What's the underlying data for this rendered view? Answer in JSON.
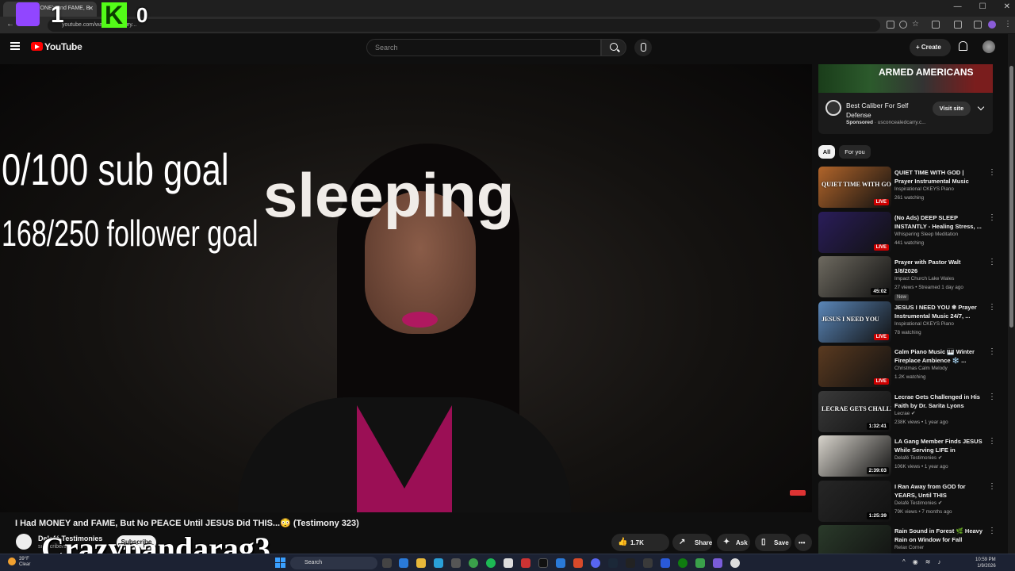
{
  "browser": {
    "tab_title": "I Had MONEY and FAME, B",
    "url": "youtube.com/watch?v=...bey...",
    "window_controls": [
      "—",
      "☐",
      "✕"
    ]
  },
  "stream_overlay": {
    "twitch_count": "1",
    "kick_letter": "K",
    "kick_count": "0",
    "sub_goal": "0/100 sub goal",
    "follower_goal": "168/250 follower goal",
    "status_text": "sleeping",
    "streamer_name": "Crazypandarag3"
  },
  "header": {
    "logo_text": "YouTube",
    "search_placeholder": "Search",
    "create_label": "+ Create"
  },
  "video": {
    "title": "I Had MONEY and FAME, But No PEACE Until JESUS Did THIS...😳 (Testimony 323)",
    "channel": "Delafé Testimonies",
    "subscribers": "subscribers",
    "subscribe_label": "Subscribe",
    "likes": "1.7K",
    "share_label": "Share",
    "ask_label": "Ask",
    "save_label": "Save",
    "more_label": "•••"
  },
  "ad": {
    "banner_text": "ARMED AMERICANS",
    "title": "Best Caliber For Self Defense",
    "sponsored_label": "Sponsored",
    "advertiser": "usconcealedcarry.c...",
    "visit_label": "Visit site"
  },
  "chips": [
    "All",
    "For you"
  ],
  "recommendations": [
    {
      "title": "QUIET TIME WITH GOD | Prayer Instrumental Music 24/7, ...",
      "channel": "Inspirational CKEYS Piano",
      "meta": "261 watching",
      "badge": "LIVE",
      "thumb_text": "QUIET TIME WITH GOD",
      "thumb_color": "#b0642a"
    },
    {
      "title": "(No Ads) DEEP SLEEP INSTANTLY - Healing Stress, ...",
      "channel": "Whispering Sleep Meditation",
      "meta": "441 watching",
      "badge": "LIVE",
      "thumb_text": "",
      "thumb_color": "#2a1d5a"
    },
    {
      "title": "Prayer with Pastor Walt 1/8/2026",
      "channel": "Impact Church Lake Wales",
      "meta": "27 views • Streamed 1 day ago",
      "badge": "45:02",
      "new_label": "New",
      "thumb_text": "",
      "thumb_color": "#6e6a60"
    },
    {
      "title": "JESUS I NEED YOU ❄ Prayer Instrumental Music 24/7, ...",
      "channel": "Inspirational CKEYS Piano",
      "meta": "78 watching",
      "badge": "LIVE",
      "thumb_text": "JESUS I NEED YOU",
      "thumb_color": "#5a86b8"
    },
    {
      "title": "Calm Piano Music 🎹 Winter Fireplace Ambience ❄️ ...",
      "channel": "Christmas Calm Melody",
      "meta": "1.2K watching",
      "badge": "LIVE",
      "thumb_text": "",
      "thumb_color": "#5a3a20"
    },
    {
      "title": "Lecrae Gets Challenged in His Faith by Dr. Sarita Lyons",
      "channel": "Lecrae ✔",
      "meta": "238K views • 1 year ago",
      "badge": "1:32:41",
      "thumb_text": "LECRAE GETS CHALLENG",
      "thumb_color": "#3a3a3a"
    },
    {
      "title": "LA Gang Member Finds JESUS While Serving LIFE in PRISON....",
      "channel": "Delafé Testimonies ✔",
      "meta": "106K views • 1 year ago",
      "badge": "2:39:03",
      "thumb_text": "",
      "thumb_color": "#d8d4cc"
    },
    {
      "title": "I Ran Away from GOD for YEARS, Until THIS Happened....",
      "channel": "Delafé Testimonies ✔",
      "meta": "79K views • 7 months ago",
      "badge": "1:25:39",
      "thumb_text": "",
      "thumb_color": "#262626"
    },
    {
      "title": "Rain Sound in Forest 🌿 Heavy Rain on Window for Fall Asleep...",
      "channel": "Relax Corner",
      "meta": "",
      "badge": "",
      "thumb_text": "",
      "thumb_color": "#2a3a2a"
    }
  ],
  "taskbar": {
    "weather_temp": "39°F",
    "weather_desc": "Clear",
    "search_label": "Search",
    "time": "10:59 PM",
    "date": "1/9/2026"
  }
}
